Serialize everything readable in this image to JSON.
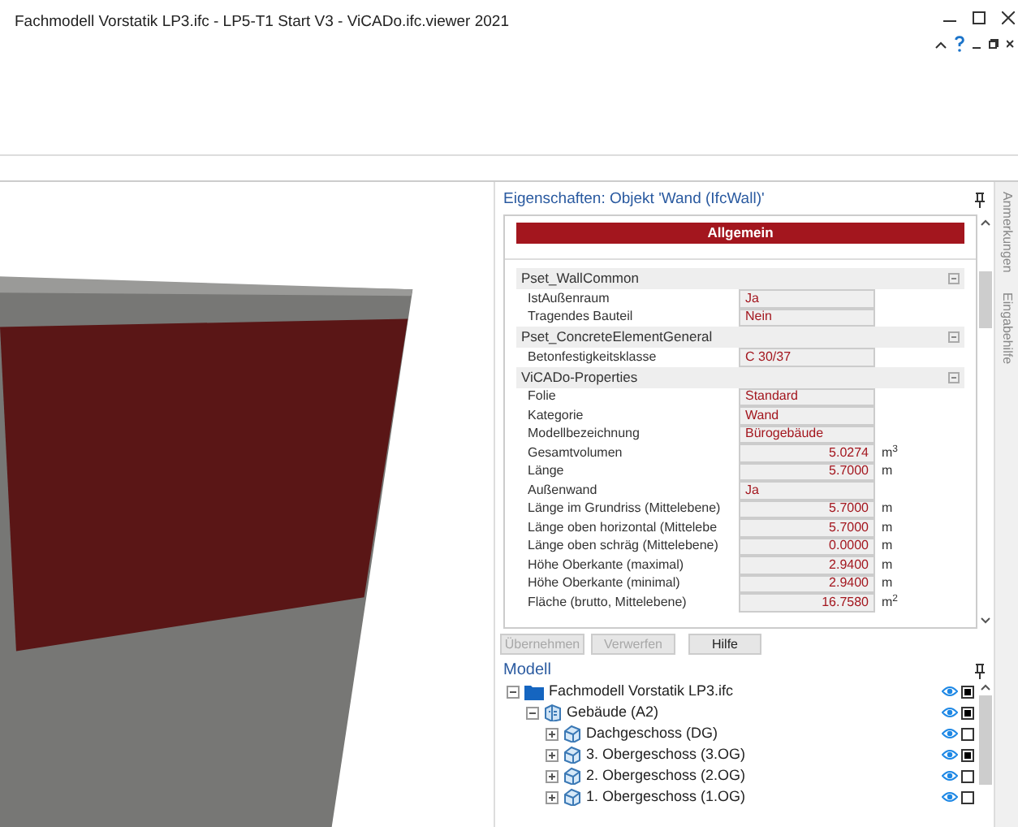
{
  "window": {
    "title": "Fachmodell Vorstatik LP3.ifc - LP5-T1 Start V3 - ViCADo.ifc.viewer 2021"
  },
  "properties": {
    "title": "Eigenschaften: Objekt 'Wand (IfcWall)'",
    "section": "Allgemein",
    "groups": [
      {
        "name": "Pset_WallCommon",
        "rows": [
          {
            "kind": "text",
            "label": "IstAußenraum",
            "value": "Ja"
          },
          {
            "kind": "text",
            "label": "Tragendes Bauteil",
            "value": "Nein"
          }
        ]
      },
      {
        "name": "Pset_ConcreteElementGeneral",
        "rows": [
          {
            "kind": "text",
            "label": "Betonfestigkeitsklasse",
            "value": "C 30/37"
          }
        ]
      },
      {
        "name": "ViCADo-Properties",
        "rows": [
          {
            "kind": "text",
            "label": "Folie",
            "value": "Standard"
          },
          {
            "kind": "text",
            "label": "Kategorie",
            "value": "Wand"
          },
          {
            "kind": "text",
            "label": "Modellbezeichnung",
            "value": "Bürogebäude"
          },
          {
            "kind": "number",
            "label": "Gesamtvolumen",
            "value": "5.0274",
            "unit": "m$^{3}$"
          },
          {
            "kind": "number",
            "label": "Länge",
            "value": "5.7000",
            "unit": "m"
          },
          {
            "kind": "text",
            "label": "Außenwand",
            "value": "Ja"
          },
          {
            "kind": "number",
            "label": "Länge im Grundriss (Mittelebene)",
            "value": "5.7000",
            "unit": "m"
          },
          {
            "kind": "number",
            "label": "Länge oben horizontal (Mittelebe",
            "value": "5.7000",
            "unit": "m"
          },
          {
            "kind": "number",
            "label": "Länge oben schräg (Mittelebene)",
            "value": "0.0000",
            "unit": "m"
          },
          {
            "kind": "number",
            "label": "Höhe Oberkante (maximal)",
            "value": "2.9400",
            "unit": "m"
          },
          {
            "kind": "number",
            "label": "Höhe Oberkante (minimal)",
            "value": "2.9400",
            "unit": "m"
          },
          {
            "kind": "number",
            "label": "Fläche (brutto, Mittelebene)",
            "value": "16.7580",
            "unit": "m$^{2}$"
          }
        ]
      }
    ],
    "buttons": [
      {
        "label": "Übernehmen",
        "disabled": true
      },
      {
        "label": "Verwerfen",
        "disabled": true
      },
      {
        "label": "Hilfe",
        "disabled": false
      }
    ]
  },
  "side_tabs": [
    "Anmerkungen",
    "Eingabehilfe"
  ],
  "model": {
    "title": "Modell",
    "tree": [
      {
        "kind": "file",
        "label": "Fachmodell Vorstatik LP3.ifc",
        "expanded": true,
        "visible": true,
        "checked": true,
        "children": [
          {
            "kind": "building",
            "label": "Gebäude (A2)",
            "expanded": true,
            "visible": true,
            "checked": true,
            "children": [
              {
                "kind": "storey",
                "label": "Dachgeschoss (DG)",
                "expanded": false,
                "visible": true,
                "checked": false
              },
              {
                "kind": "storey",
                "label": "3. Obergeschoss (3.OG)",
                "expanded": false,
                "visible": true,
                "checked": true
              },
              {
                "kind": "storey",
                "label": "2. Obergeschoss (2.OG)",
                "expanded": false,
                "visible": true,
                "checked": false
              },
              {
                "kind": "storey",
                "label": "1. Obergeschoss (1.OG)",
                "expanded": false,
                "visible": true,
                "checked": false
              }
            ]
          }
        ]
      }
    ]
  }
}
